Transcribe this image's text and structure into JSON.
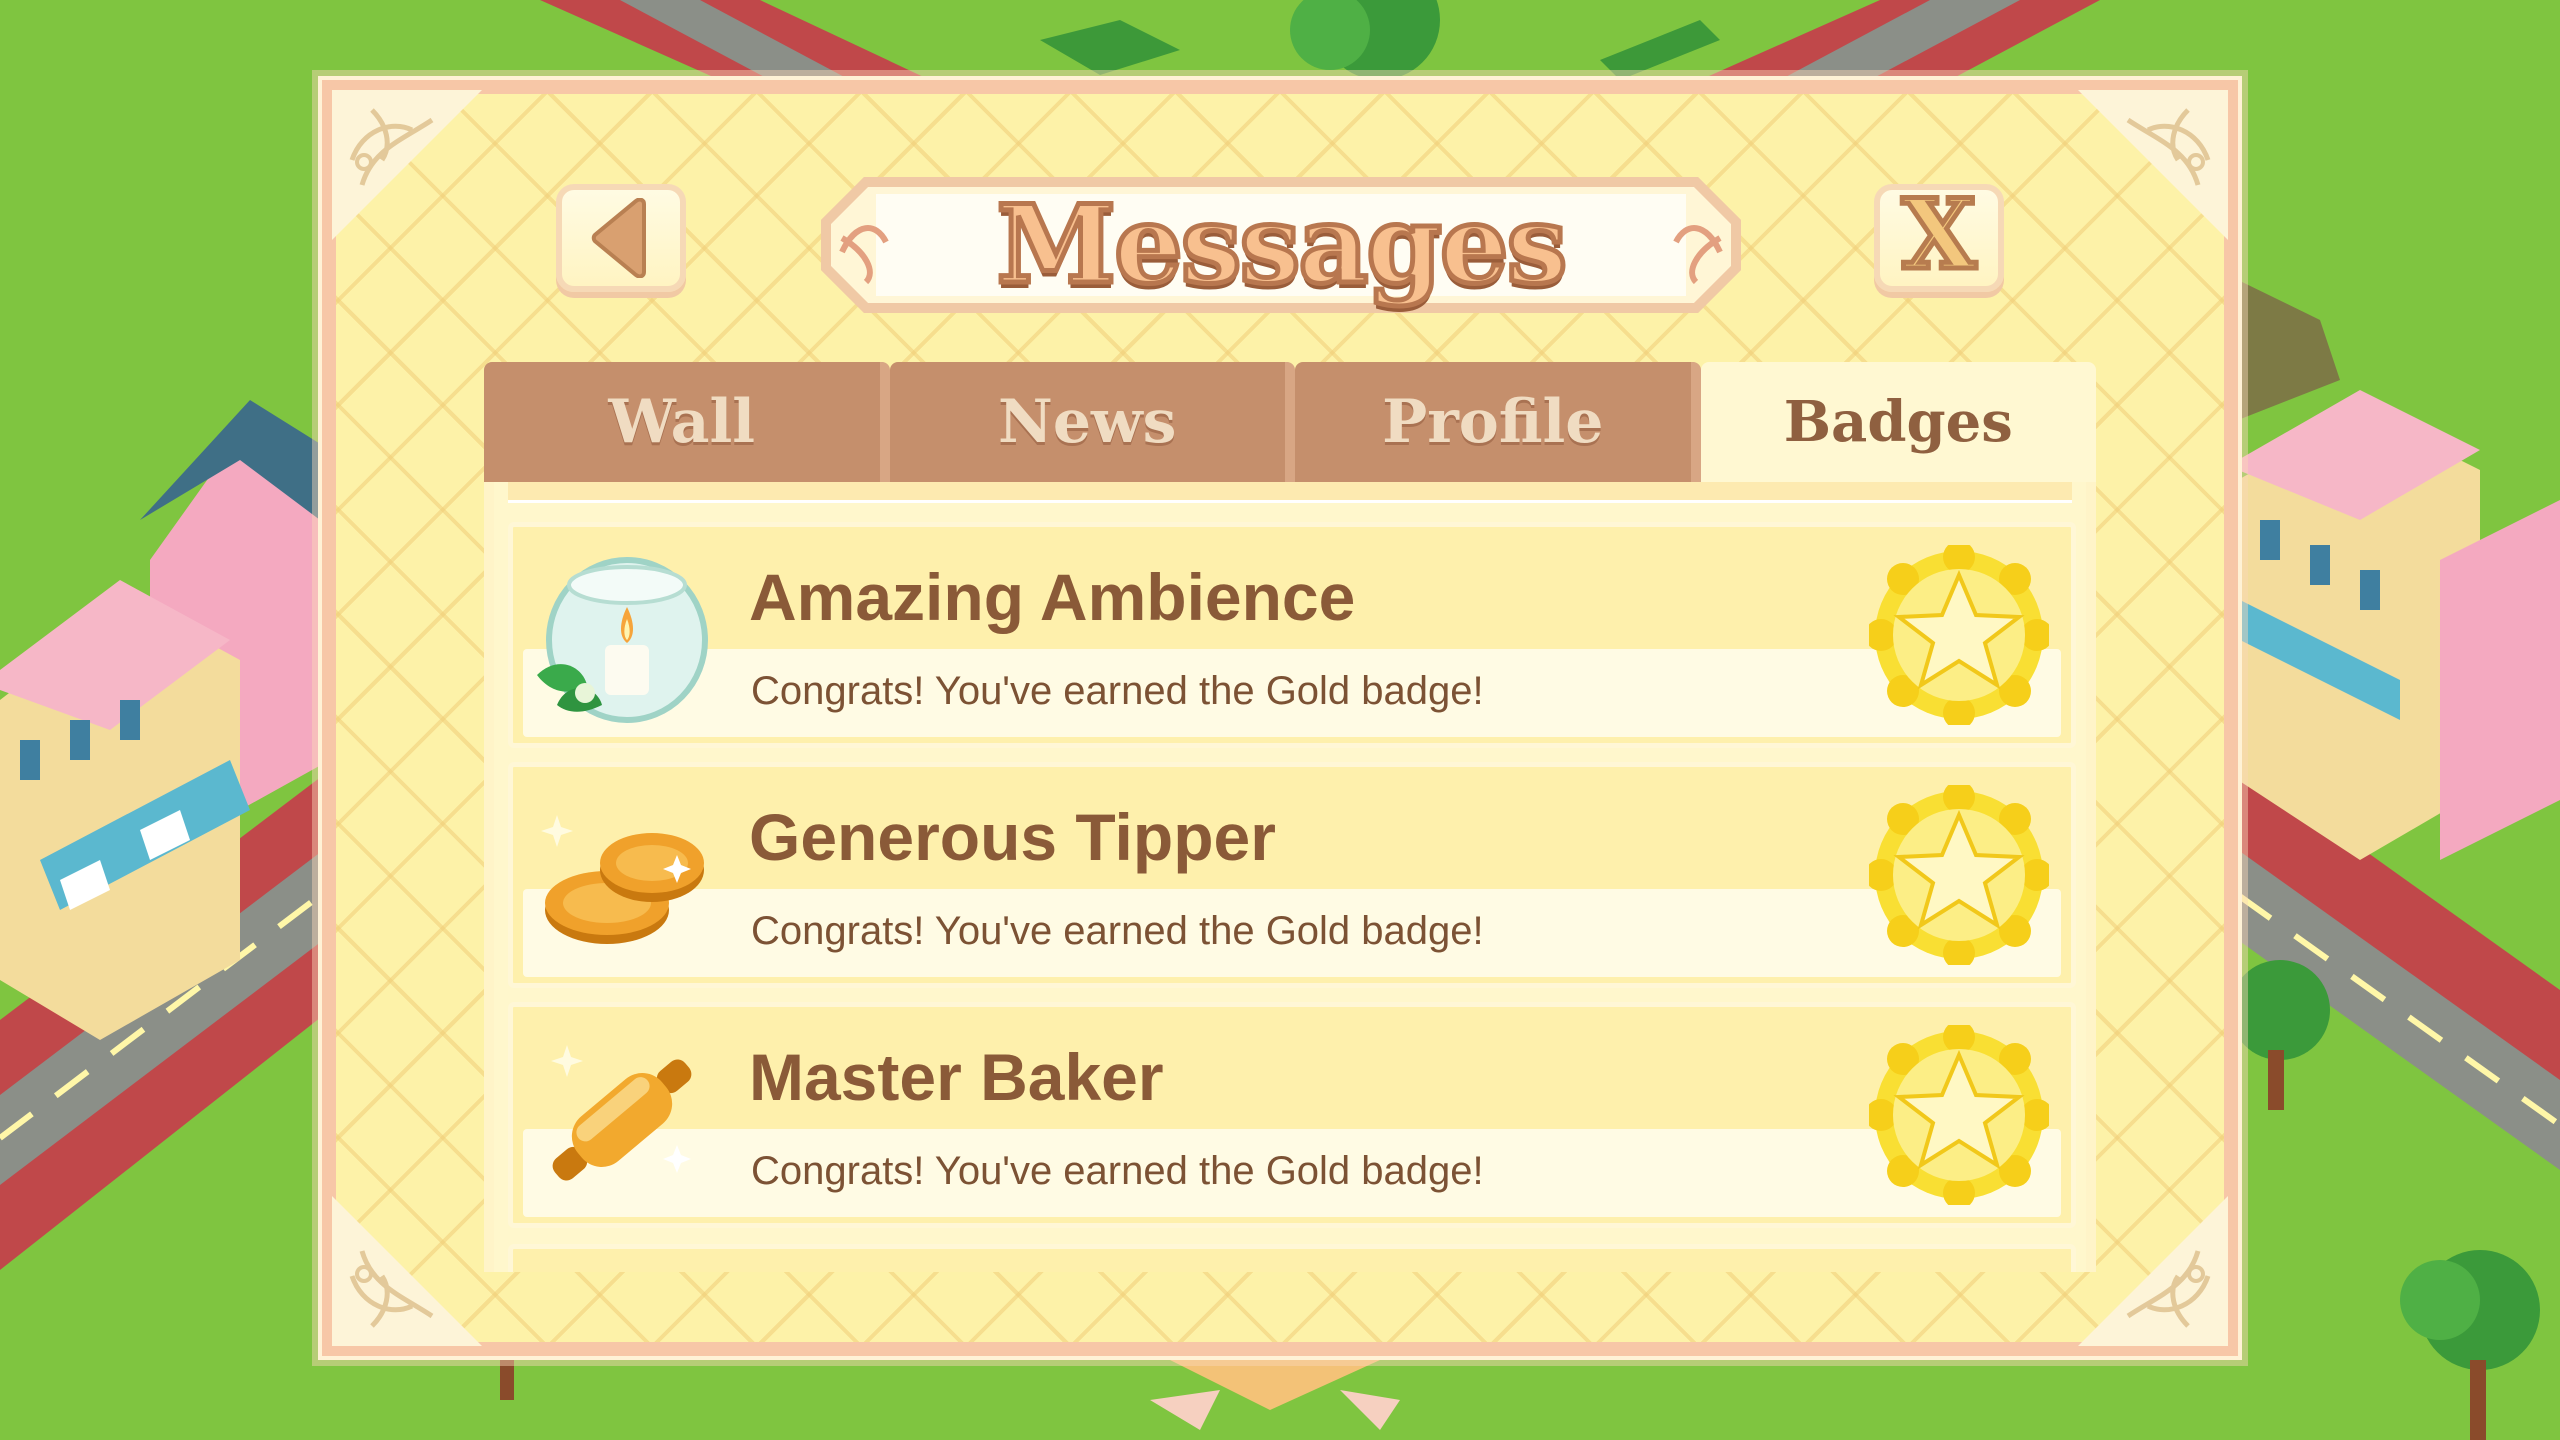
{
  "header": {
    "title": "Messages",
    "back_icon": "triangle-left-icon",
    "close_label": "X"
  },
  "tabs": [
    {
      "label": "Wall",
      "active": false
    },
    {
      "label": "News",
      "active": false
    },
    {
      "label": "Profile",
      "active": false
    },
    {
      "label": "Badges",
      "active": true
    }
  ],
  "badges": [
    {
      "title": "Amazing Ambience",
      "message": "Congrats! You've earned the Gold badge!",
      "icon": "candle-bowl-icon",
      "level_icon": "gold-star-icon"
    },
    {
      "title": "Generous Tipper",
      "message": "Congrats! You've earned the Gold badge!",
      "icon": "gold-coins-icon",
      "level_icon": "gold-star-icon"
    },
    {
      "title": "Master Baker",
      "message": "Congrats! You've earned the Gold badge!",
      "icon": "rolling-pin-icon",
      "level_icon": "gold-star-icon"
    }
  ],
  "colors": {
    "panel": "#fdf2a8",
    "tab_inactive": "#c58f6c",
    "tab_active": "#fff8d2",
    "text_brown": "#8a5a38",
    "gold": "#f7d41f"
  }
}
